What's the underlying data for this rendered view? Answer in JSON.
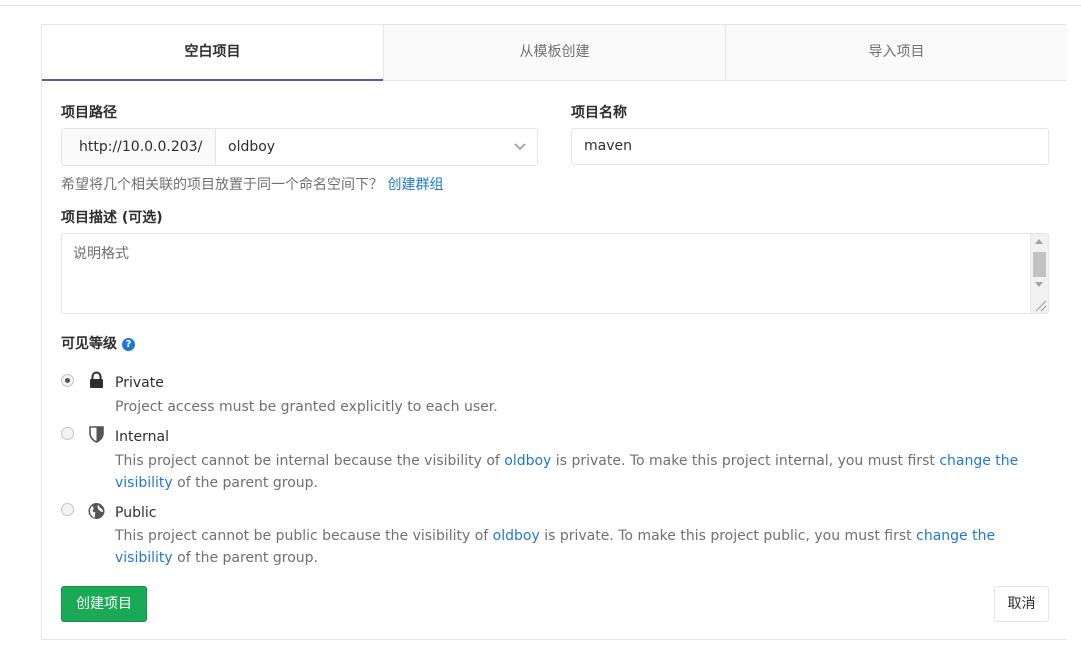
{
  "tabs": [
    {
      "label": "空白项目",
      "active": true
    },
    {
      "label": "从模板创建",
      "active": false
    },
    {
      "label": "导入项目",
      "active": false
    }
  ],
  "form": {
    "path_label": "项目路径",
    "url_prefix": "http://10.0.0.203/",
    "namespace_value": "oldboy",
    "name_label": "项目名称",
    "name_value": "maven",
    "namespace_help": "希望将几个相关联的项目放置于同一个命名空间下？",
    "create_group_link": "创建群组",
    "description_label": "项目描述 (可选)",
    "description_placeholder": "说明格式",
    "visibility_label": "可见等级",
    "visibility_help_glyph": "?"
  },
  "visibility": {
    "private": {
      "title": "Private",
      "icon": "lock-icon",
      "checked": true,
      "desc": "Project access must be granted explicitly to each user."
    },
    "internal": {
      "title": "Internal",
      "icon": "shield-icon",
      "checked": false,
      "desc_1": "This project cannot be internal because the visibility of ",
      "group_link": "oldboy",
      "desc_2": " is private. To make this project internal, you must first ",
      "change_link": "change the visibility",
      "desc_3": " of the parent group."
    },
    "public": {
      "title": "Public",
      "icon": "globe-icon",
      "checked": false,
      "desc_1": "This project cannot be public because the visibility of ",
      "group_link": "oldboy",
      "desc_2": " is private. To make this project public, you must first ",
      "change_link": "change the visibility",
      "desc_3": " of the parent group."
    }
  },
  "buttons": {
    "create": "创建项目",
    "cancel": "取消"
  },
  "colors": {
    "accent": "#6b4fbb",
    "link": "#1f78d1",
    "create_button": "#1aaa55"
  }
}
